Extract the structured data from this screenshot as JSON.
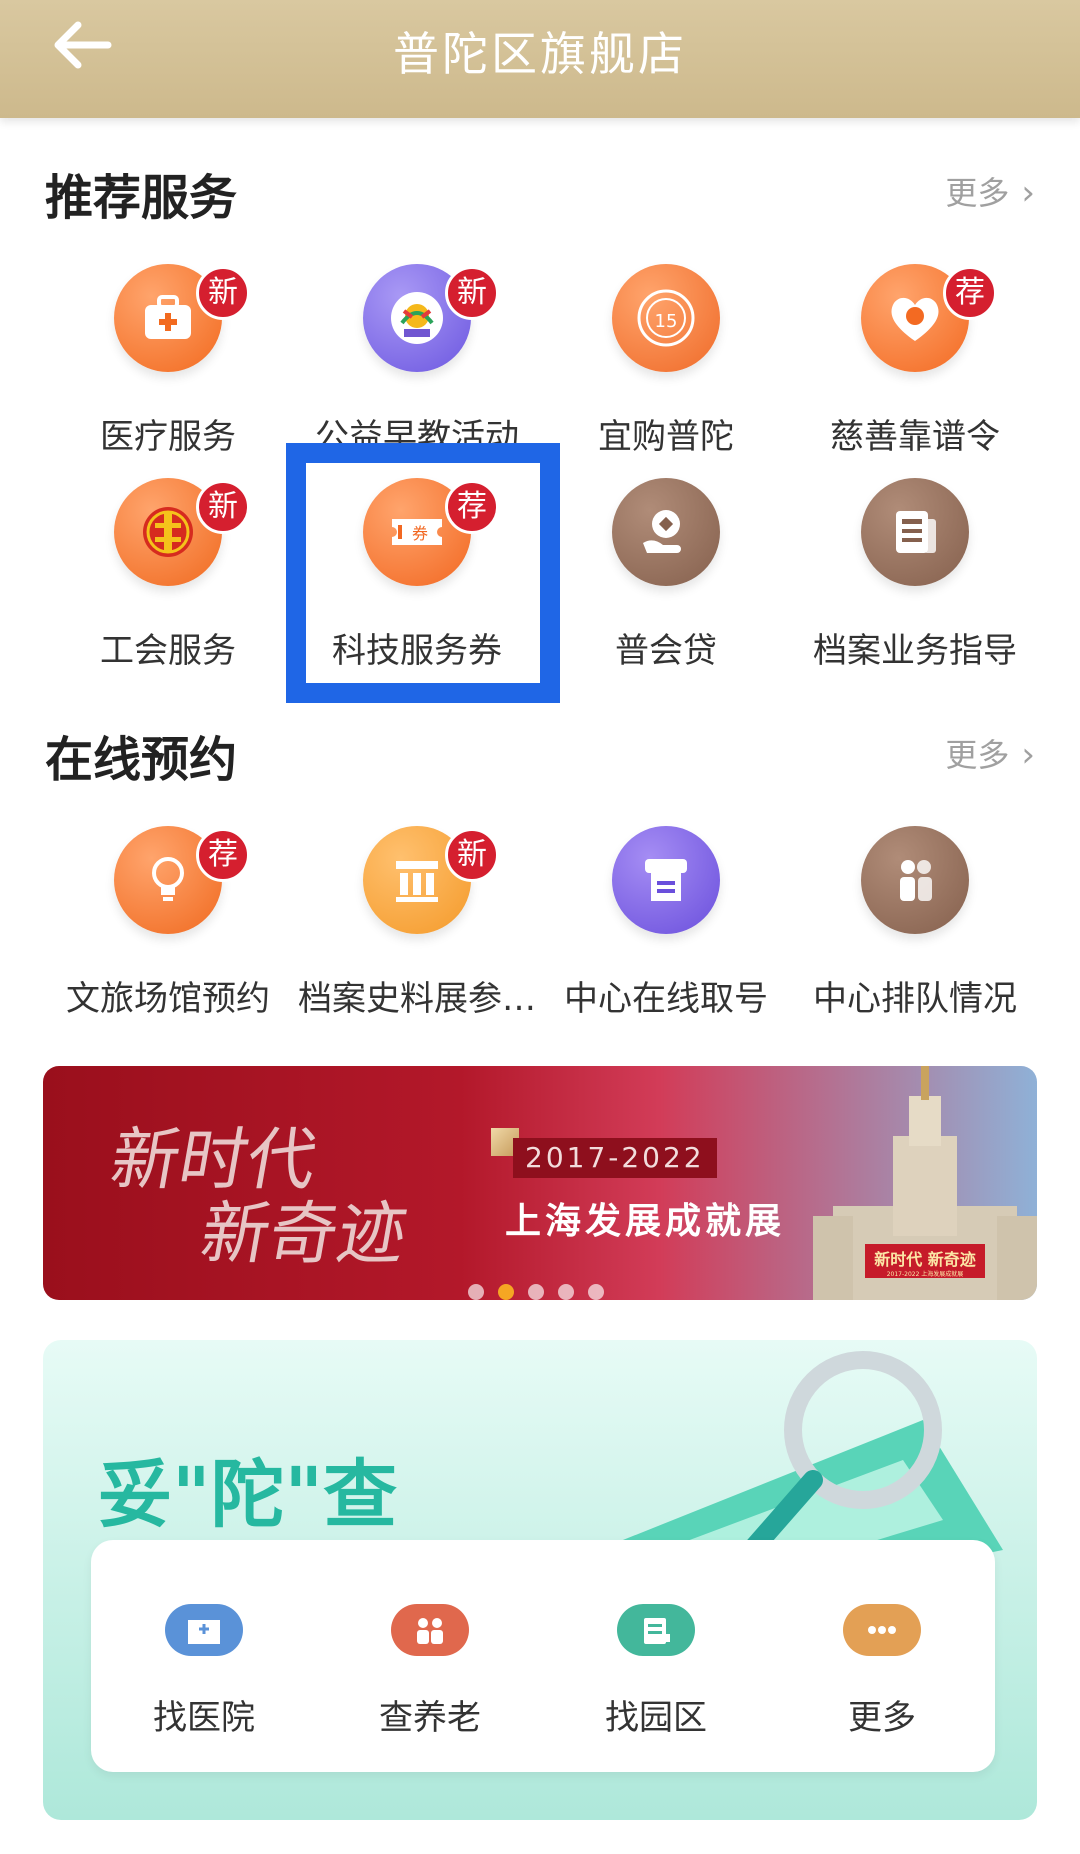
{
  "header": {
    "title": "普陀区旗舰店"
  },
  "recommended": {
    "title": "推荐服务",
    "more": "更多",
    "items": [
      {
        "label": "医疗服务",
        "badge": "新",
        "icon": "medical-kit-icon"
      },
      {
        "label": "公益早教活动",
        "badge": "新",
        "icon": "charity-logo-icon"
      },
      {
        "label": "宜购普陀",
        "badge": "",
        "icon": "putuo-seal-icon"
      },
      {
        "label": "慈善靠谱令",
        "badge": "荐",
        "icon": "heart-icon"
      },
      {
        "label": "工会服务",
        "badge": "新",
        "icon": "union-emblem-icon"
      },
      {
        "label": "科技服务券",
        "badge": "荐",
        "icon": "voucher-icon"
      },
      {
        "label": "普会贷",
        "badge": "",
        "icon": "loan-icon"
      },
      {
        "label": "档案业务指导",
        "badge": "",
        "icon": "archive-icon"
      }
    ]
  },
  "booking": {
    "title": "在线预约",
    "more": "更多",
    "items": [
      {
        "label": "文旅场馆预约",
        "badge": "荐",
        "icon": "lightbulb-icon"
      },
      {
        "label": "档案史料展参…",
        "badge": "新",
        "icon": "museum-icon"
      },
      {
        "label": "中心在线取号",
        "badge": "",
        "icon": "ticket-machine-icon"
      },
      {
        "label": "中心排队情况",
        "badge": "",
        "icon": "queue-icon"
      }
    ]
  },
  "banner": {
    "calligraphy_line1": "新时代",
    "calligraphy_line2": "新奇迹",
    "years": "2017-2022",
    "subtitle": "上海发展成就展",
    "sign_text": "新时代 新奇迹",
    "sign_small": "2017-2022 上海发展成就展",
    "page_count": 5,
    "active_page": 2
  },
  "panel": {
    "title": "妥\"陀\"查",
    "items": [
      {
        "label": "找医院",
        "icon": "hospital-icon",
        "color": "#5a92d8"
      },
      {
        "label": "查养老",
        "icon": "elderly-care-icon",
        "color": "#e0684d"
      },
      {
        "label": "找园区",
        "icon": "park-document-icon",
        "color": "#43b79b"
      },
      {
        "label": "更多",
        "icon": "more-dots-icon",
        "color": "#e3a055"
      }
    ]
  },
  "colors": {
    "header_gold": "#d4c196",
    "badge_red": "#d51f2f",
    "highlight_blue": "#1f66e6",
    "orange_icon": "#f57b2d",
    "brown_icon": "#946b57"
  }
}
